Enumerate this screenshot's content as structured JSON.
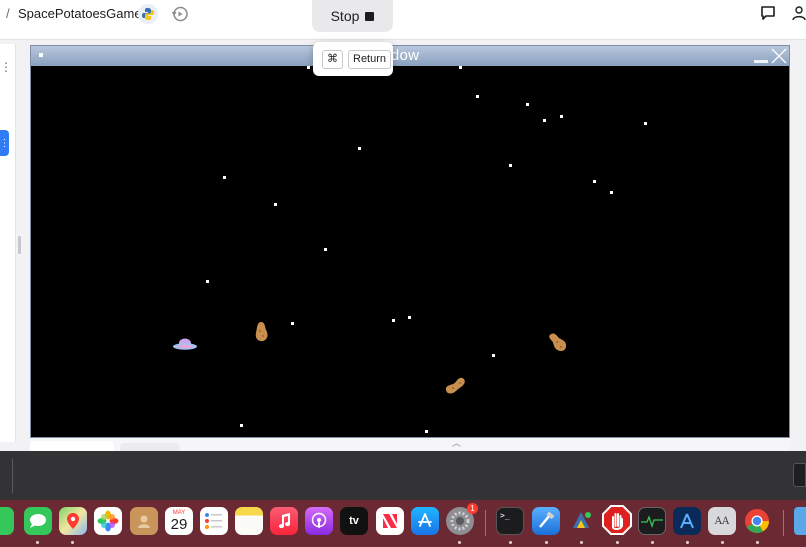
{
  "topbar": {
    "breadcrumb_separator": "/",
    "project_name": "SpacePotatoesGame",
    "stop_label": "Stop",
    "icons": [
      "python-icon",
      "history-icon",
      "chat-icon",
      "user-icon"
    ]
  },
  "tooltip": {
    "modifier": "⌘",
    "key": "Return"
  },
  "game_window": {
    "title": "e Window",
    "background": "#000000",
    "titlebar_color": "#9fb2cc"
  },
  "dock": {
    "apps": [
      "FaceTime",
      "Messages",
      "Maps",
      "Photos",
      "Contacts",
      "Calendar",
      "Reminders",
      "Notes",
      "Music",
      "Podcasts",
      "TV",
      "News",
      "App Store",
      "System Settings",
      "Terminal",
      "Xcode",
      "Python Launcher",
      "AdBlock",
      "Activity Monitor",
      "Instruments",
      "Font Book",
      "Chrome",
      "Folder"
    ],
    "calendar_month": "MAY",
    "calendar_day": "29",
    "tv_label": "tv",
    "settings_badge": "1"
  },
  "colors": {
    "dock_bg": "#6b2a33",
    "console_bg": "#333335",
    "accent": "#2f7cf6"
  }
}
